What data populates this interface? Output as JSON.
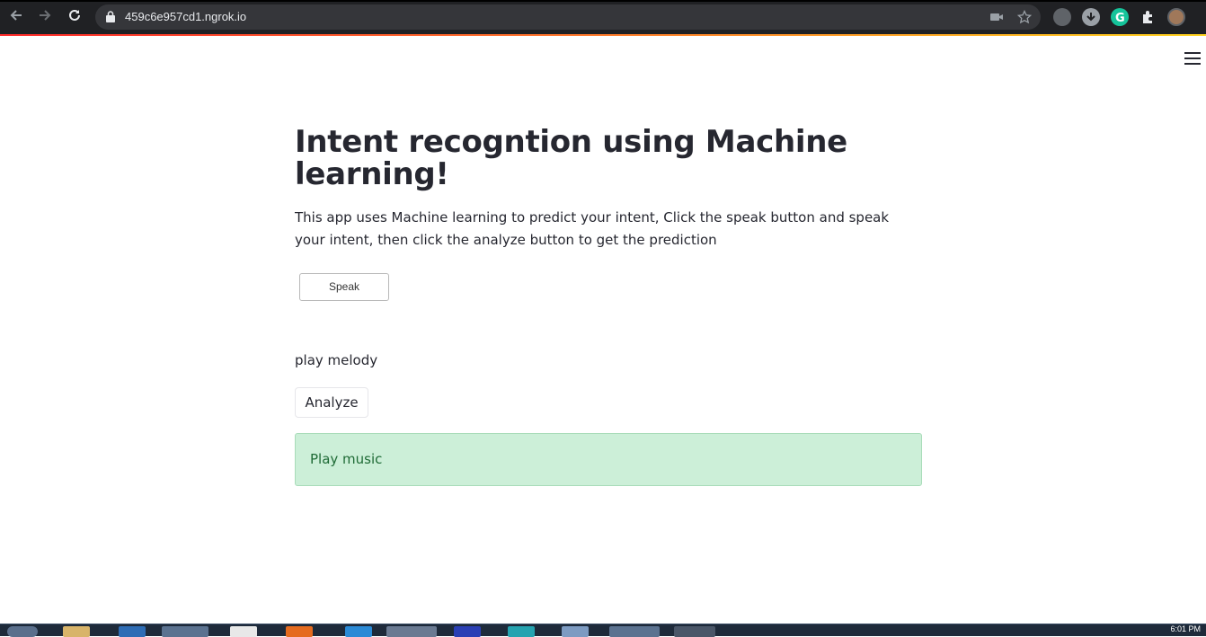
{
  "browser": {
    "url": "459c6e957cd1.ngrok.io",
    "icons": [
      "back-arrow-icon",
      "forward-arrow-icon",
      "reload-icon",
      "lock-icon",
      "camera-blocked-icon",
      "star-icon",
      "extension-icon",
      "download-icon",
      "grammarly-icon",
      "puzzle-icon",
      "avatar"
    ]
  },
  "app": {
    "title": "Intent recogntion using Machine learning!",
    "description": "This app uses Machine learning to predict your intent, Click the speak button and speak your intent, then click the analyze button to get the prediction",
    "speak_button": "Speak",
    "transcript": "play melody",
    "analyze_button": "Analyze",
    "result": "Play music",
    "colors": {
      "result_bg": "#ccefd8",
      "result_text": "#1f6b36",
      "text": "#262730"
    }
  },
  "taskbar": {
    "clock": "6:01 PM"
  }
}
